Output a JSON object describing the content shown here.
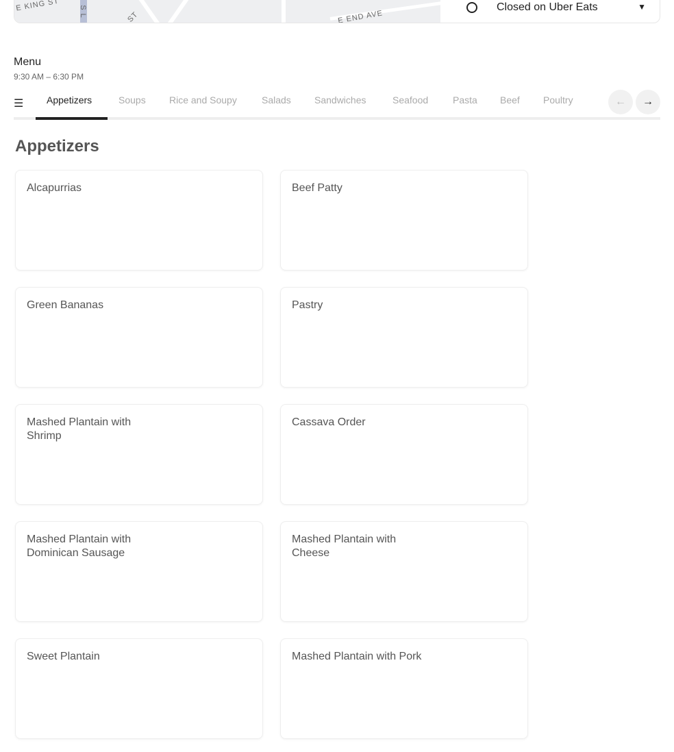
{
  "map": {
    "streets": [
      "E KING ST",
      "S L",
      "ST",
      "E END AVE"
    ]
  },
  "store_status": {
    "label": "Closed on Uber Eats",
    "icon": "clock-icon"
  },
  "menu": {
    "title": "Menu",
    "hours": "9:30 AM – 6:30 PM"
  },
  "tabs": [
    "Appetizers",
    "Soups",
    "Rice and Soupy",
    "Salads",
    "Sandwiches",
    "Seafood",
    "Pasta",
    "Beef",
    "Poultry"
  ],
  "active_tab": "Appetizers",
  "section_title": "Appetizers",
  "items": [
    "Alcapurrias",
    "Beef Patty",
    "Green Bananas",
    "Pastry",
    "Mashed Plantain with Shrimp",
    "Cassava Order",
    "Mashed Plantain with Dominican Sausage",
    "Mashed Plantain with Cheese",
    "Sweet Plantain",
    "Mashed Plantain with Pork"
  ]
}
